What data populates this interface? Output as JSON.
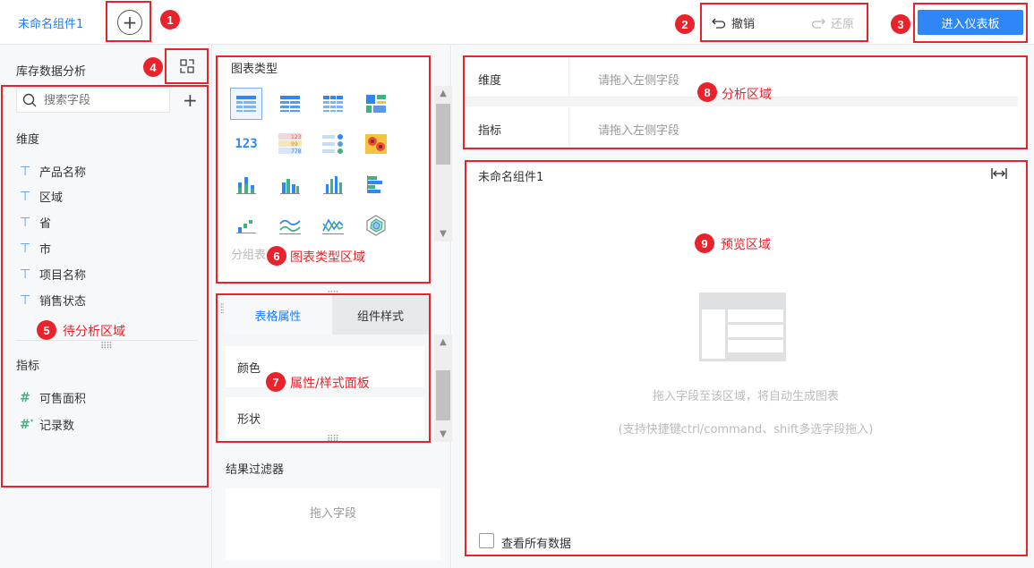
{
  "topbar": {
    "tab_title": "未命名组件1",
    "add_icon": "plus-circle-icon",
    "undo_label": "撤销",
    "redo_label": "还原",
    "enter_dashboard_label": "进入仪表板",
    "accent_color": "#2f86f6"
  },
  "annotations": {
    "color": "#e8232b",
    "badges": [
      "1",
      "2",
      "3",
      "4",
      "5",
      "6",
      "7",
      "8",
      "9"
    ],
    "labels": {
      "pending_area": "待分析区域",
      "chart_type_area": "图表类型区域",
      "property_panel": "属性/样式面板",
      "analysis_area": "分析区域",
      "preview_area": "预览区域"
    }
  },
  "left_panel": {
    "dataset_title": "库存数据分析",
    "switch_icon": "switch-dataset-icon",
    "search_placeholder": "搜索字段",
    "dimensions_title": "维度",
    "dimensions": [
      {
        "label": "产品名称",
        "icon": "text-field-icon"
      },
      {
        "label": "区域",
        "icon": "text-field-icon"
      },
      {
        "label": "省",
        "icon": "text-field-icon"
      },
      {
        "label": "市",
        "icon": "text-field-icon"
      },
      {
        "label": "项目名称",
        "icon": "text-field-icon"
      },
      {
        "label": "销售状态",
        "icon": "text-field-icon"
      }
    ],
    "measures_title": "指标",
    "measures": [
      {
        "label": "可售面积",
        "icon": "number-field-icon"
      },
      {
        "label": "记录数",
        "icon": "count-field-icon"
      }
    ]
  },
  "chart_types": {
    "title": "图表类型",
    "group_label": "分组表",
    "icons": [
      "grouped-table-icon",
      "crosstab-icon",
      "detail-table-icon",
      "treemap-icon",
      "kpi-number-icon",
      "kpi-card-icon",
      "kpi-list-icon",
      "heatmap-icon",
      "stacked-column-icon",
      "grouped-column-icon",
      "column-icon",
      "bar-icon",
      "waterfall-icon",
      "line-icon",
      "area-line-icon",
      "radar-icon"
    ],
    "kpi_card_values": [
      "123",
      "99",
      "778"
    ]
  },
  "property_panel": {
    "tab_table_props": "表格属性",
    "tab_component_style": "组件样式",
    "color_label": "颜色",
    "shape_label": "形状"
  },
  "filter": {
    "title": "结果过滤器",
    "drop_hint": "拖入字段"
  },
  "analysis": {
    "dimension_label": "维度",
    "dimension_placeholder": "请拖入左侧字段",
    "measure_label": "指标",
    "measure_placeholder": "请拖入左侧字段"
  },
  "preview": {
    "title": "未命名组件1",
    "expand_icon": "expand-width-icon",
    "hint_main": "拖入字段至该区域，将自动生成图表",
    "hint_sub": "(支持快捷键ctrl/command、shift多选字段拖入)",
    "view_all_label": "查看所有数据"
  }
}
